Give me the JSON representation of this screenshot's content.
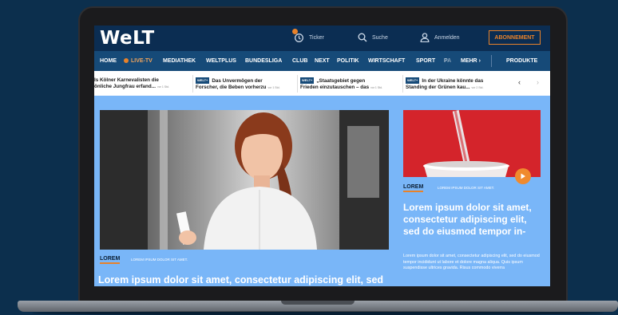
{
  "header": {
    "logo": "WeLT",
    "ticker_label": "Ticker",
    "search_label": "Suche",
    "login_label": "Anmelden",
    "subscribe_label": "ABONNEMENT"
  },
  "nav": {
    "items": [
      "HOME",
      "LIVE-TV",
      "MEDIATHEK",
      "WELTPLUS",
      "BUNDESLIGA",
      "CLUB",
      "NEXT",
      "POLITIK",
      "WIRTSCHAFT",
      "SPORT",
      "PA"
    ],
    "more_label": "MEHR",
    "products_label": "PRODUKTE"
  },
  "ticker": {
    "items": [
      {
        "line1": "Is Kölner Karnevalisten die",
        "line2": "önliche Jungfrau erfand...",
        "tag": "",
        "meta": "vor 1 Std."
      },
      {
        "line1": "Das Unvermögen der",
        "line2": "Forscher, die Beben vorherzu",
        "tag": "WELT+",
        "meta": "vor 1 Std."
      },
      {
        "line1": "„Staatsgebiet gegen",
        "line2": "Frieden einzutauschen – das",
        "tag": "WELT+",
        "meta": "vor 1 Std."
      },
      {
        "line1": "In der Ukraine könnte das",
        "line2": "Standing der Grünen kau...",
        "tag": "WELT+",
        "meta": "vor 2 Std."
      }
    ]
  },
  "main_story": {
    "kicker": "LOREM",
    "kicker_sub": "LOREM IPSUM DOLOR SIT AMET.",
    "headline": "Lorem ipsum dolor sit amet, consectetur adipiscing elit, sed"
  },
  "side_story": {
    "kicker": "LOREM",
    "kicker_sub": "LOREM IPSUM DOLOR SIT AMET.",
    "headline": "Lorem ipsum dolor sit amet, consectetur adipiscing elit, sed do eiusmod tempor in-",
    "body": "Lorem ipsum dolor sit amet, consectetur adipiscing elit, sed do eiusmod tempor incididunt ut labore et dolore magna aliqua. Quis ipsum suspendisse ultrices gravida. Risus commodo viverra"
  },
  "colors": {
    "brand_navy": "#0b2d52",
    "nav_blue": "#164a78",
    "accent_orange": "#e8822a",
    "page_blue": "#79b6f8"
  }
}
